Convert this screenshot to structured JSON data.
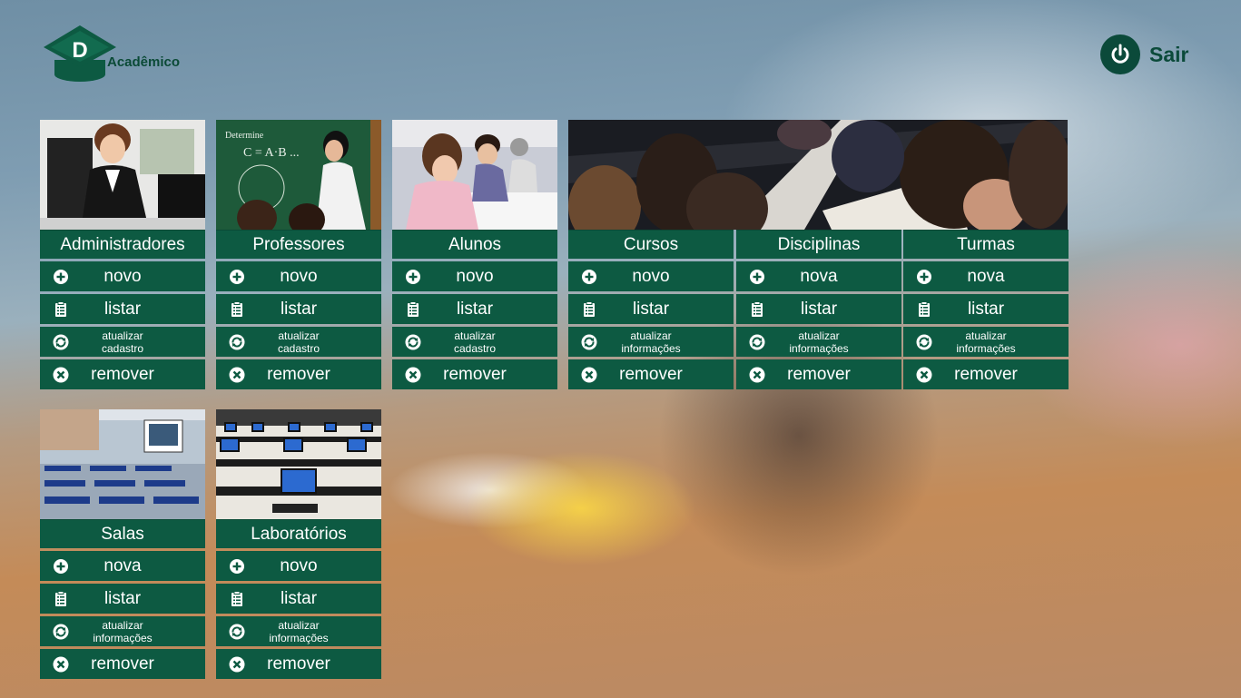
{
  "app": {
    "logo_letter": "D",
    "logo_text": "Acadêmico",
    "exit_label": "Sair"
  },
  "colors": {
    "tile": "#0d5a42",
    "accent": "#0b4a3a",
    "text": "#ffffff"
  },
  "cards": [
    {
      "title": "Administradores",
      "actions": [
        "novo",
        "listar",
        "atualizar cadastro",
        "remover"
      ]
    },
    {
      "title": "Professores",
      "actions": [
        "novo",
        "listar",
        "atualizar cadastro",
        "remover"
      ]
    },
    {
      "title": "Alunos",
      "actions": [
        "novo",
        "listar",
        "atualizar cadastro",
        "remover"
      ]
    },
    {
      "title": "Cursos",
      "actions": [
        "novo",
        "listar",
        "atualizar informações",
        "remover"
      ]
    },
    {
      "title": "Disciplinas",
      "actions": [
        "nova",
        "listar",
        "atualizar informações",
        "remover"
      ]
    },
    {
      "title": "Turmas",
      "actions": [
        "nova",
        "listar",
        "atualizar informações",
        "remover"
      ]
    },
    {
      "title": "Salas",
      "actions": [
        "nova",
        "listar",
        "atualizar informações",
        "remover"
      ]
    },
    {
      "title": "Laboratórios",
      "actions": [
        "novo",
        "listar",
        "atualizar informações",
        "remover"
      ]
    }
  ],
  "action_icons": [
    "plus-circle-icon",
    "clipboard-icon",
    "refresh-icon",
    "close-circle-icon"
  ]
}
